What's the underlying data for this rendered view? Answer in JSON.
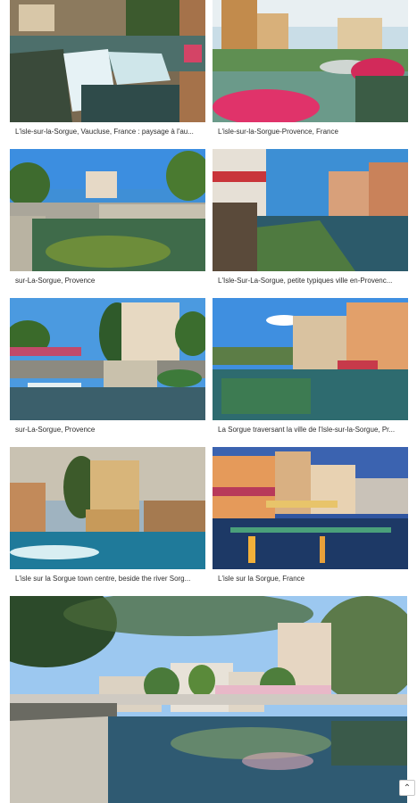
{
  "gallery": {
    "items": [
      {
        "caption": "L'isle-sur-la-Sorgue, Vaucluse, France : paysage à l'au..."
      },
      {
        "caption": "L'isle-sur-la-Sorgue-Provence, France"
      },
      {
        "caption": "sur-La-Sorgue, Provence"
      },
      {
        "caption": "L'Isle-Sur-La-Sorgue, petite typiques ville en-Provenc..."
      },
      {
        "caption": "sur-La-Sorgue, Provence"
      },
      {
        "caption": "La Sorgue traversant la ville de l'Isle-sur-la-Sorgue, Pr..."
      },
      {
        "caption": "L'isle sur la Sorgue town centre, beside the river Sorg..."
      },
      {
        "caption": "L'isle sur la Sorgue, France"
      }
    ]
  },
  "scroll_top": {
    "icon": "chevron-up-icon",
    "glyph": "⌃"
  }
}
